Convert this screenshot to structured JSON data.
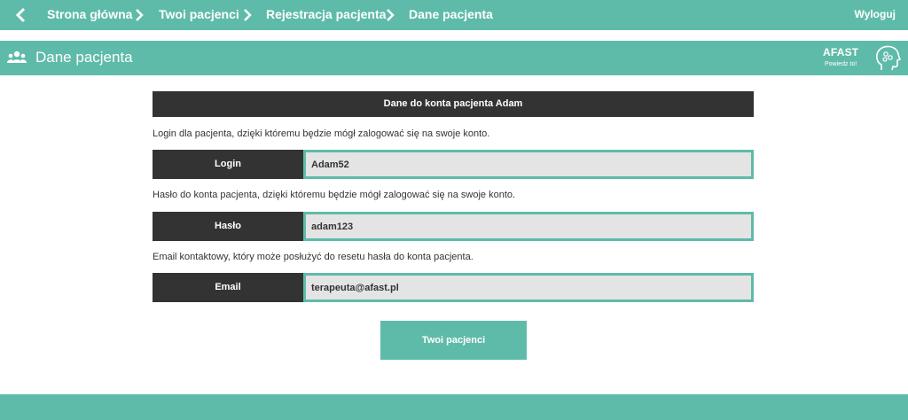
{
  "nav": {
    "back_icon": "chevron-left-icon",
    "breadcrumbs": [
      "Strona główna",
      "Twoi pacjenci",
      "Rejestracja pacjenta",
      "Dane pacjenta"
    ],
    "logout_label": "Wyloguj"
  },
  "header": {
    "icon": "users-icon",
    "title": "Dane pacjenta",
    "logo_brand": "AFAST",
    "logo_tagline": "Powiedz to!"
  },
  "panel": {
    "heading": "Dane do konta pacjenta Adam",
    "fields": [
      {
        "description": "Login dla pacjenta, dzięki któremu będzie mógł zalogować się na swoje konto.",
        "label": "Login",
        "value": "Adam52"
      },
      {
        "description": "Hasło do konta pacjenta, dzięki któremu będzie mógł zalogować się na swoje konto.",
        "label": "Hasło",
        "value": "adam123"
      },
      {
        "description": "Email kontaktowy, który może posłużyć do resetu hasła do konta pacjenta.",
        "label": "Email",
        "value": "terapeuta@afast.pl"
      }
    ],
    "button_label": "Twoi pacjenci"
  },
  "colors": {
    "accent": "#5fbba9",
    "dark": "#333333",
    "field_bg": "#e4e4e4"
  }
}
